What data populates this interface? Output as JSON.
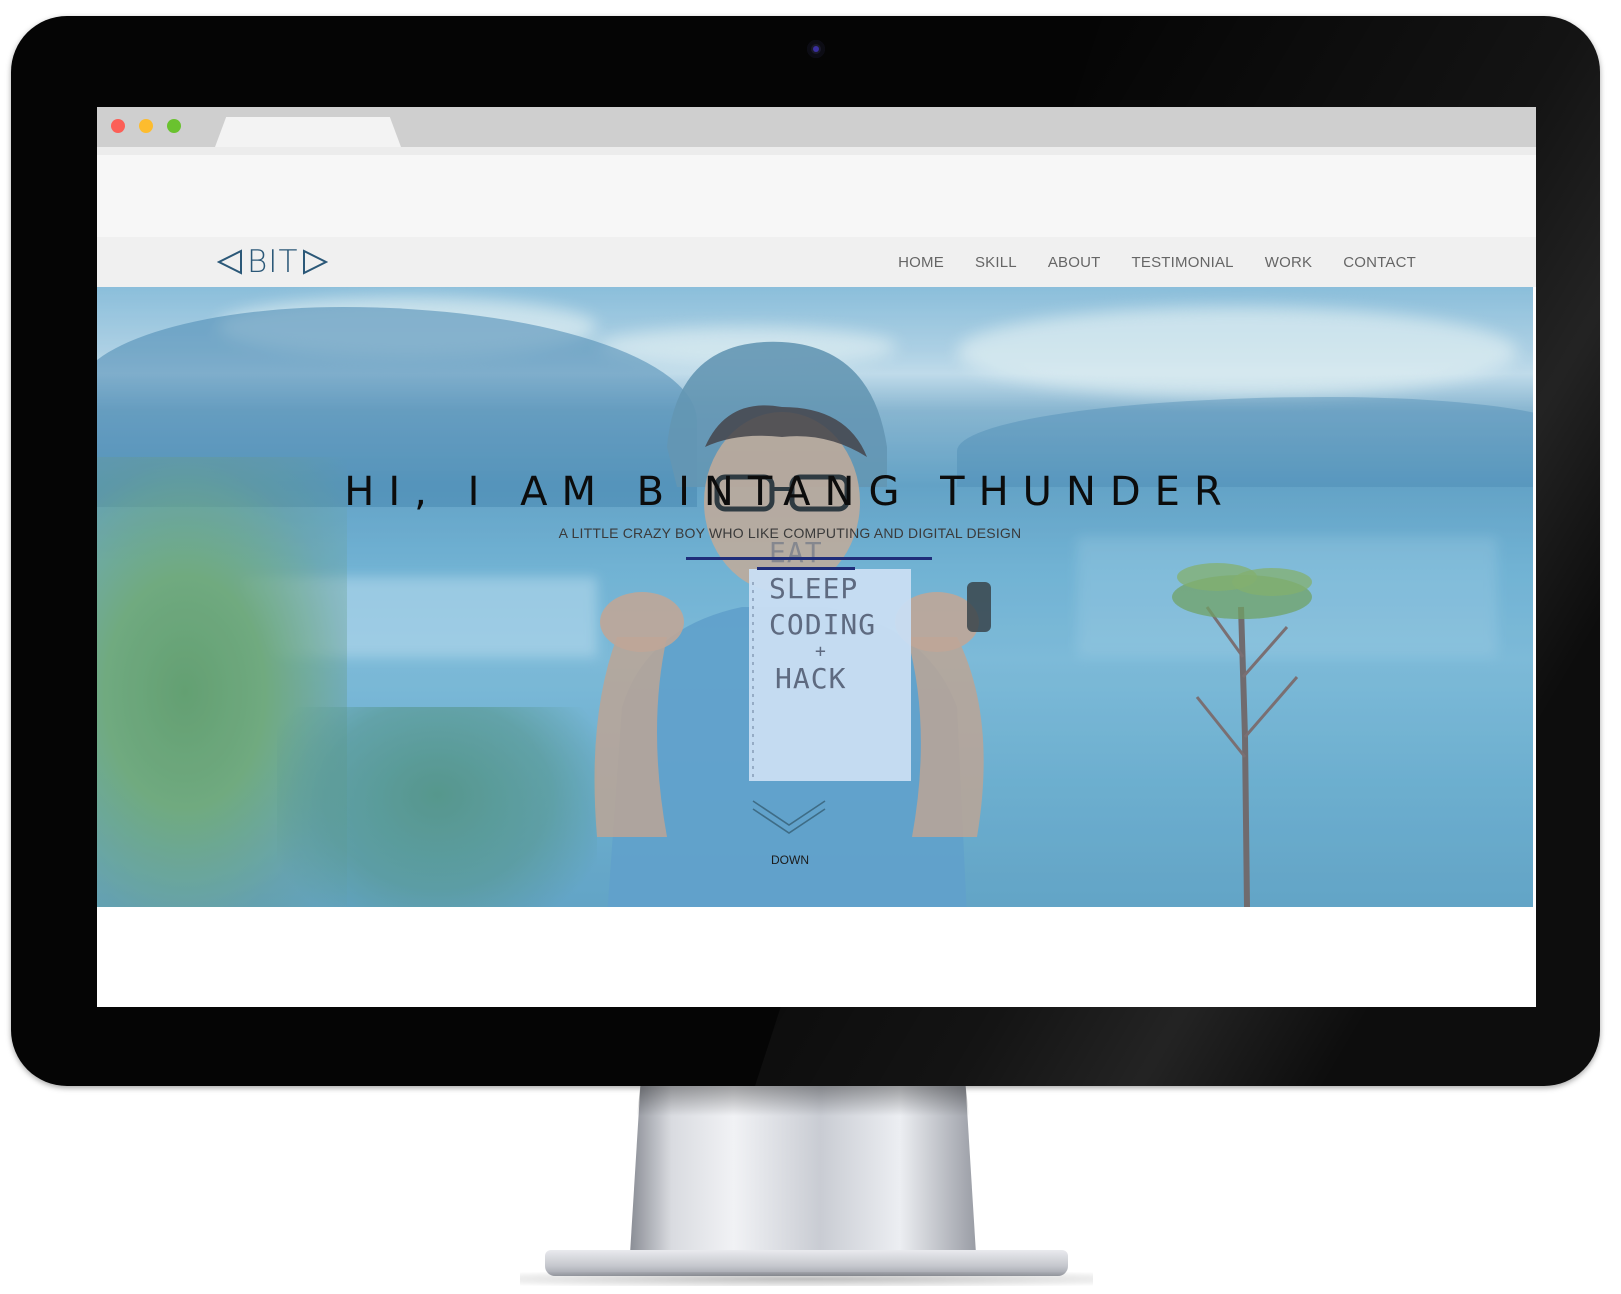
{
  "brand": {
    "logo_text": "BIT"
  },
  "nav": {
    "items": [
      {
        "label": "HOME"
      },
      {
        "label": "SKILL"
      },
      {
        "label": "ABOUT"
      },
      {
        "label": "TESTIMONIAL"
      },
      {
        "label": "WORK"
      },
      {
        "label": "CONTACT"
      }
    ]
  },
  "hero": {
    "title": "HI, I AM BINTANG THUNDER",
    "subtitle": "A LITTLE CRAZY BOY WHO LIKE COMPUTING AND DIGITAL DESIGN",
    "note_lines": [
      "EAT",
      "SLEEP",
      "CODING",
      "+",
      "HACK"
    ],
    "down_label": "DOWN"
  },
  "colors": {
    "accent_line": "#1f2d7a",
    "logo": "#2b5878",
    "nav_text": "#666666",
    "traffic_red": "#fc5f57",
    "traffic_yellow": "#fdbc2e",
    "traffic_green": "#6ac22f"
  },
  "icons": {
    "logo_left": "triangle-left-icon",
    "logo_right": "triangle-right-icon",
    "scroll_down": "chevron-down-icon"
  }
}
